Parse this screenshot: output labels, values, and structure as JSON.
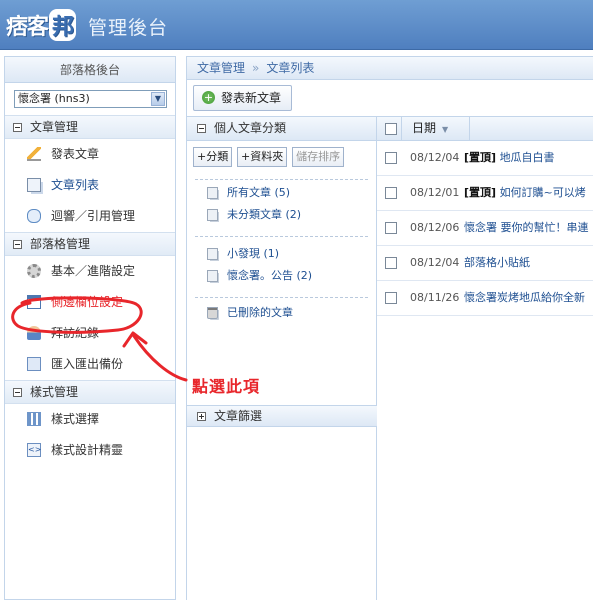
{
  "header": {
    "logo_text": "痞客邦",
    "app_title": "管理後台"
  },
  "sidebar": {
    "title": "部落格後台",
    "blog_select": "懷念署 (hns3)",
    "sections": [
      {
        "title": "文章管理",
        "items": [
          {
            "label": "發表文章",
            "icon": "pencil-icon"
          },
          {
            "label": "文章列表",
            "icon": "documents-icon"
          },
          {
            "label": "迴響／引用管理",
            "icon": "comment-bubble-icon"
          }
        ]
      },
      {
        "title": "部落格管理",
        "items": [
          {
            "label": "基本／進階設定",
            "icon": "gear-icon"
          },
          {
            "label": "側邊欄位設定",
            "icon": "layout-icon"
          },
          {
            "label": "拜訪紀錄",
            "icon": "people-icon"
          },
          {
            "label": "匯入匯出備份",
            "icon": "import-export-icon"
          }
        ]
      },
      {
        "title": "樣式管理",
        "items": [
          {
            "label": "樣式選擇",
            "icon": "grid-icon"
          },
          {
            "label": "樣式設計精靈",
            "icon": "code-icon"
          }
        ]
      }
    ]
  },
  "main": {
    "breadcrumb": [
      "文章管理",
      "文章列表"
    ],
    "breadcrumb_sep": "»",
    "new_post_button": "發表新文章",
    "categories": {
      "title": "個人文章分類",
      "buttons": [
        "+分類",
        "+資料夾",
        "儲存排序"
      ],
      "group1": [
        {
          "label": "所有文章 (5)"
        },
        {
          "label": "未分類文章 (2)"
        }
      ],
      "group2": [
        {
          "label": "小發現 (1)"
        },
        {
          "label": "懷念署。公告 (2)"
        }
      ],
      "trash": "已刪除的文章",
      "filter_title": "文章篩選"
    },
    "list": {
      "date_header": "日期",
      "rows": [
        {
          "date": "08/12/04",
          "pin": "[置頂]",
          "title": "地瓜自白書"
        },
        {
          "date": "08/12/01",
          "pin": "[置頂]",
          "title": "如何訂購~可以烤"
        },
        {
          "date": "08/12/06",
          "pin": "",
          "title": "懷念署 要你的幫忙！串連"
        },
        {
          "date": "08/12/04",
          "pin": "",
          "title": "部落格小貼紙"
        },
        {
          "date": "08/11/26",
          "pin": "",
          "title": "懷念署炭烤地瓜給你全新"
        }
      ]
    }
  },
  "annotation": {
    "text": "點選此項",
    "color": "#e8262b"
  }
}
